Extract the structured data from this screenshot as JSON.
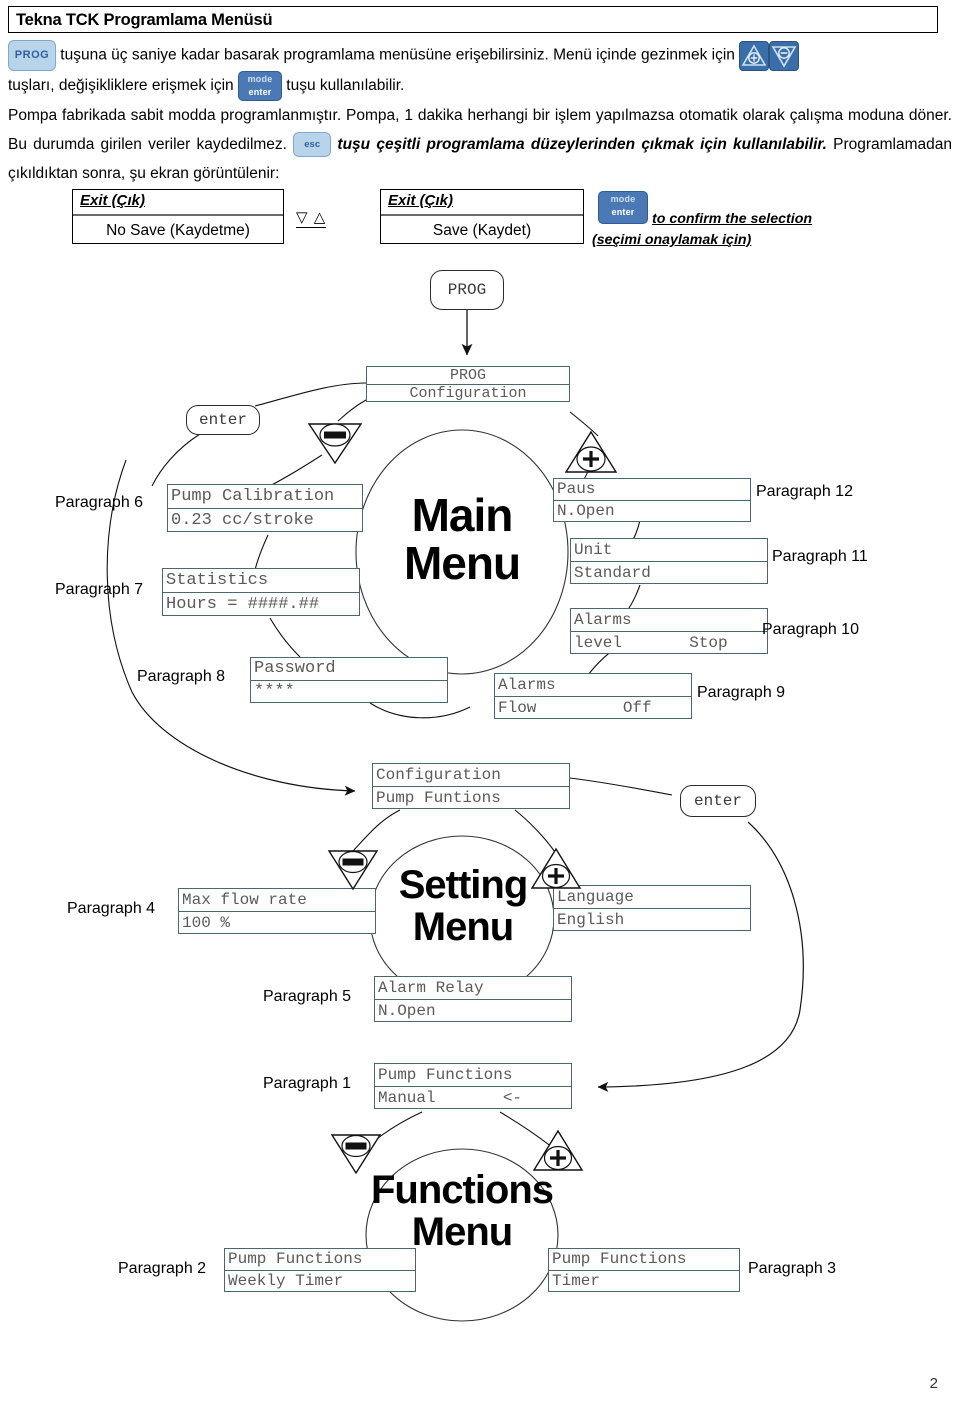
{
  "document": {
    "title": "Tekna TCK Programlama Menüsü",
    "page_number": "2"
  },
  "intro": {
    "seg1": " tuşuna üç saniye kadar basarak programlama menüsüne erişebilirsiniz. Menü içinde gezinmek için",
    "seg2": "tuşları, değişikliklere erişmek için ",
    "seg3": " tuşu kullanılabilir.",
    "seg4": "Pompa fabrikada sabit modda programlanmıştır. Pompa, 1 dakika herhangi bir işlem yapılmazsa otomatik olarak çalışma moduna döner. Bu durumda girilen veriler kaydedilmez. ",
    "seg5": "tuşu çeşitli programlama düzeylerinden çıkmak için kullanılabilir.",
    "seg6": " Programlamadan çıkıldıktan sonra, şu ekran görüntülenir:"
  },
  "keys": {
    "prog": "PROG",
    "esc": "esc",
    "mode": "mode",
    "enter": "enter"
  },
  "exit_panels": {
    "left": {
      "title": "Exit (Çık)",
      "value": "No Save (Kaydetme)"
    },
    "right": {
      "title": "Exit (Çık)",
      "value": "Save (Kaydet)"
    },
    "updown_glyph": "▽ △",
    "confirm_line1": "to confirm the selection",
    "confirm_line2": "(seçimi onaylamak için)"
  },
  "diagram": {
    "prog_button": "PROG",
    "enter_button_top": "enter",
    "enter_button_mid": "enter",
    "menus": {
      "main": "Main\nMenu",
      "setting": "Setting\nMenu",
      "functions": "Functions\nMenu"
    },
    "screens": {
      "prog_config": {
        "l1": "PROG",
        "l2": "Configuration"
      },
      "pump_calibration": {
        "l1": "Pump Calibration",
        "l2": "0.23 cc/stroke"
      },
      "statistics": {
        "l1": "Statistics",
        "l2": "Hours = ####.##"
      },
      "password": {
        "l1": "Password",
        "l2": "****"
      },
      "paus": {
        "l1": "Paus",
        "l2": "N.Open"
      },
      "unit": {
        "l1": "Unit",
        "l2": "Standard"
      },
      "alarms_level": {
        "l1": "Alarms",
        "l2": "level       Stop"
      },
      "alarms_flow": {
        "l1": "Alarms",
        "l2": "Flow         Off"
      },
      "config_pump_funtions": {
        "l1": "Configuration",
        "l2": "Pump Funtions"
      },
      "max_flow_rate": {
        "l1": "Max flow rate",
        "l2": "100 %"
      },
      "language": {
        "l1": "Language",
        "l2": "English"
      },
      "alarm_relay": {
        "l1": "Alarm Relay",
        "l2": "N.Open"
      },
      "pump_functions_manual": {
        "l1": "Pump Functions",
        "l2": "Manual       <-"
      },
      "pump_functions_weekly": {
        "l1": "Pump Functions",
        "l2": "Weekly Timer"
      },
      "pump_functions_timer": {
        "l1": "Pump Functions",
        "l2": "Timer"
      }
    },
    "paragraph_labels": {
      "p12": "Paragraph 12",
      "p11": "Paragraph 11",
      "p10": "Paragraph 10",
      "p9": "Paragraph 9",
      "p8": "Paragraph 8",
      "p7": "Paragraph 7",
      "p6": "Paragraph 6",
      "p5": "Paragraph 5",
      "p4": "Paragraph 4",
      "p3": "Paragraph 3",
      "p2": "Paragraph 2",
      "p1": "Paragraph 1"
    }
  },
  "colors": {
    "key_light_blue": "#b8d4ea",
    "key_dark_blue": "#3a6ea8",
    "lcd_border": "#4a6670",
    "lcd_text": "#5a5a5a"
  }
}
